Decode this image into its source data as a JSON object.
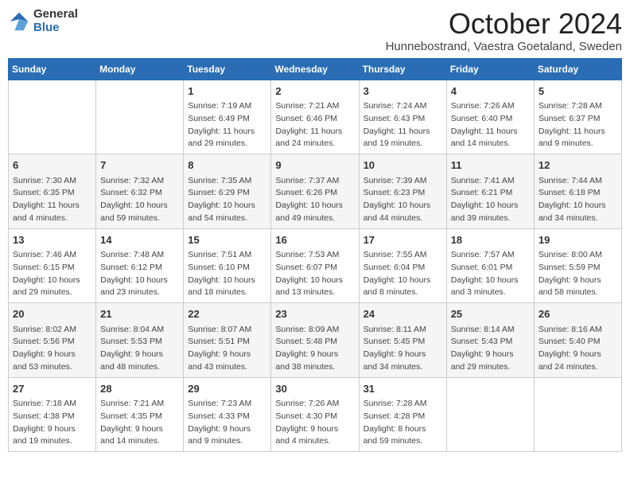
{
  "logo": {
    "text_general": "General",
    "text_blue": "Blue"
  },
  "title": "October 2024",
  "location": "Hunnebostrand, Vaestra Goetaland, Sweden",
  "weekdays": [
    "Sunday",
    "Monday",
    "Tuesday",
    "Wednesday",
    "Thursday",
    "Friday",
    "Saturday"
  ],
  "weeks": [
    [
      {
        "day": "",
        "content": ""
      },
      {
        "day": "",
        "content": ""
      },
      {
        "day": "1",
        "content": "Sunrise: 7:19 AM\nSunset: 6:49 PM\nDaylight: 11 hours\nand 29 minutes."
      },
      {
        "day": "2",
        "content": "Sunrise: 7:21 AM\nSunset: 6:46 PM\nDaylight: 11 hours\nand 24 minutes."
      },
      {
        "day": "3",
        "content": "Sunrise: 7:24 AM\nSunset: 6:43 PM\nDaylight: 11 hours\nand 19 minutes."
      },
      {
        "day": "4",
        "content": "Sunrise: 7:26 AM\nSunset: 6:40 PM\nDaylight: 11 hours\nand 14 minutes."
      },
      {
        "day": "5",
        "content": "Sunrise: 7:28 AM\nSunset: 6:37 PM\nDaylight: 11 hours\nand 9 minutes."
      }
    ],
    [
      {
        "day": "6",
        "content": "Sunrise: 7:30 AM\nSunset: 6:35 PM\nDaylight: 11 hours\nand 4 minutes."
      },
      {
        "day": "7",
        "content": "Sunrise: 7:32 AM\nSunset: 6:32 PM\nDaylight: 10 hours\nand 59 minutes."
      },
      {
        "day": "8",
        "content": "Sunrise: 7:35 AM\nSunset: 6:29 PM\nDaylight: 10 hours\nand 54 minutes."
      },
      {
        "day": "9",
        "content": "Sunrise: 7:37 AM\nSunset: 6:26 PM\nDaylight: 10 hours\nand 49 minutes."
      },
      {
        "day": "10",
        "content": "Sunrise: 7:39 AM\nSunset: 6:23 PM\nDaylight: 10 hours\nand 44 minutes."
      },
      {
        "day": "11",
        "content": "Sunrise: 7:41 AM\nSunset: 6:21 PM\nDaylight: 10 hours\nand 39 minutes."
      },
      {
        "day": "12",
        "content": "Sunrise: 7:44 AM\nSunset: 6:18 PM\nDaylight: 10 hours\nand 34 minutes."
      }
    ],
    [
      {
        "day": "13",
        "content": "Sunrise: 7:46 AM\nSunset: 6:15 PM\nDaylight: 10 hours\nand 29 minutes."
      },
      {
        "day": "14",
        "content": "Sunrise: 7:48 AM\nSunset: 6:12 PM\nDaylight: 10 hours\nand 23 minutes."
      },
      {
        "day": "15",
        "content": "Sunrise: 7:51 AM\nSunset: 6:10 PM\nDaylight: 10 hours\nand 18 minutes."
      },
      {
        "day": "16",
        "content": "Sunrise: 7:53 AM\nSunset: 6:07 PM\nDaylight: 10 hours\nand 13 minutes."
      },
      {
        "day": "17",
        "content": "Sunrise: 7:55 AM\nSunset: 6:04 PM\nDaylight: 10 hours\nand 8 minutes."
      },
      {
        "day": "18",
        "content": "Sunrise: 7:57 AM\nSunset: 6:01 PM\nDaylight: 10 hours\nand 3 minutes."
      },
      {
        "day": "19",
        "content": "Sunrise: 8:00 AM\nSunset: 5:59 PM\nDaylight: 9 hours\nand 58 minutes."
      }
    ],
    [
      {
        "day": "20",
        "content": "Sunrise: 8:02 AM\nSunset: 5:56 PM\nDaylight: 9 hours\nand 53 minutes."
      },
      {
        "day": "21",
        "content": "Sunrise: 8:04 AM\nSunset: 5:53 PM\nDaylight: 9 hours\nand 48 minutes."
      },
      {
        "day": "22",
        "content": "Sunrise: 8:07 AM\nSunset: 5:51 PM\nDaylight: 9 hours\nand 43 minutes."
      },
      {
        "day": "23",
        "content": "Sunrise: 8:09 AM\nSunset: 5:48 PM\nDaylight: 9 hours\nand 38 minutes."
      },
      {
        "day": "24",
        "content": "Sunrise: 8:11 AM\nSunset: 5:45 PM\nDaylight: 9 hours\nand 34 minutes."
      },
      {
        "day": "25",
        "content": "Sunrise: 8:14 AM\nSunset: 5:43 PM\nDaylight: 9 hours\nand 29 minutes."
      },
      {
        "day": "26",
        "content": "Sunrise: 8:16 AM\nSunset: 5:40 PM\nDaylight: 9 hours\nand 24 minutes."
      }
    ],
    [
      {
        "day": "27",
        "content": "Sunrise: 7:18 AM\nSunset: 4:38 PM\nDaylight: 9 hours\nand 19 minutes."
      },
      {
        "day": "28",
        "content": "Sunrise: 7:21 AM\nSunset: 4:35 PM\nDaylight: 9 hours\nand 14 minutes."
      },
      {
        "day": "29",
        "content": "Sunrise: 7:23 AM\nSunset: 4:33 PM\nDaylight: 9 hours\nand 9 minutes."
      },
      {
        "day": "30",
        "content": "Sunrise: 7:26 AM\nSunset: 4:30 PM\nDaylight: 9 hours\nand 4 minutes."
      },
      {
        "day": "31",
        "content": "Sunrise: 7:28 AM\nSunset: 4:28 PM\nDaylight: 8 hours\nand 59 minutes."
      },
      {
        "day": "",
        "content": ""
      },
      {
        "day": "",
        "content": ""
      }
    ]
  ]
}
